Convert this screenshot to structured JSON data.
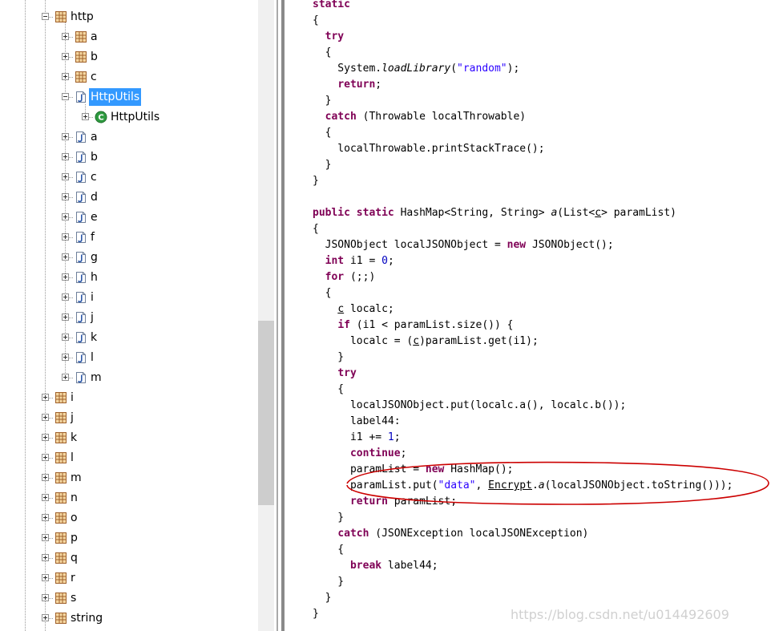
{
  "tree": {
    "rows": [
      {
        "label": "http"
      },
      {
        "label": "a"
      },
      {
        "label": "b"
      },
      {
        "label": "c"
      },
      {
        "label": "HttpUtils"
      },
      {
        "label": "HttpUtils"
      },
      {
        "label": "a"
      },
      {
        "label": "b"
      },
      {
        "label": "c"
      },
      {
        "label": "d"
      },
      {
        "label": "e"
      },
      {
        "label": "f"
      },
      {
        "label": "g"
      },
      {
        "label": "h"
      },
      {
        "label": "i"
      },
      {
        "label": "j"
      },
      {
        "label": "k"
      },
      {
        "label": "l"
      },
      {
        "label": "m"
      },
      {
        "label": "i"
      },
      {
        "label": "j"
      },
      {
        "label": "k"
      },
      {
        "label": "l"
      },
      {
        "label": "m"
      },
      {
        "label": "n"
      },
      {
        "label": "o"
      },
      {
        "label": "p"
      },
      {
        "label": "q"
      },
      {
        "label": "r"
      },
      {
        "label": "s"
      },
      {
        "label": "string"
      }
    ]
  },
  "code": {
    "lines": [
      [
        {
          "t": "static",
          "c": "kw"
        }
      ],
      [
        {
          "t": "{"
        }
      ],
      [
        {
          "t": "  "
        },
        {
          "t": "try",
          "c": "kw"
        }
      ],
      [
        {
          "t": "  {"
        }
      ],
      [
        {
          "t": "    System."
        },
        {
          "t": "loadLibrary",
          "c": "it"
        },
        {
          "t": "("
        },
        {
          "t": "\"random\"",
          "c": "str"
        },
        {
          "t": ");"
        }
      ],
      [
        {
          "t": "    "
        },
        {
          "t": "return",
          "c": "kw"
        },
        {
          "t": ";"
        }
      ],
      [
        {
          "t": "  }"
        }
      ],
      [
        {
          "t": "  "
        },
        {
          "t": "catch",
          "c": "kw"
        },
        {
          "t": " (Throwable localThrowable)"
        }
      ],
      [
        {
          "t": "  {"
        }
      ],
      [
        {
          "t": "    localThrowable.printStackTrace();"
        }
      ],
      [
        {
          "t": "  }"
        }
      ],
      [
        {
          "t": "}"
        }
      ],
      [
        {
          "t": ""
        }
      ],
      [
        {
          "t": "public",
          "c": "kw"
        },
        {
          "t": " "
        },
        {
          "t": "static",
          "c": "kw"
        },
        {
          "t": " HashMap<String, String> "
        },
        {
          "t": "a",
          "c": "it"
        },
        {
          "t": "(List<"
        },
        {
          "t": "c",
          "c": "ul"
        },
        {
          "t": "> paramList)"
        }
      ],
      [
        {
          "t": "{"
        }
      ],
      [
        {
          "t": "  JSONObject localJSONObject = "
        },
        {
          "t": "new",
          "c": "kw"
        },
        {
          "t": " JSONObject();"
        }
      ],
      [
        {
          "t": "  "
        },
        {
          "t": "int",
          "c": "kw"
        },
        {
          "t": " i1 = "
        },
        {
          "t": "0",
          "c": "num"
        },
        {
          "t": ";"
        }
      ],
      [
        {
          "t": "  "
        },
        {
          "t": "for",
          "c": "kw"
        },
        {
          "t": " (;;)"
        }
      ],
      [
        {
          "t": "  {"
        }
      ],
      [
        {
          "t": "    "
        },
        {
          "t": "c",
          "c": "ul"
        },
        {
          "t": " localc;"
        }
      ],
      [
        {
          "t": "    "
        },
        {
          "t": "if",
          "c": "kw"
        },
        {
          "t": " (i1 < paramList.size()) {"
        }
      ],
      [
        {
          "t": "      localc = ("
        },
        {
          "t": "c",
          "c": "ul"
        },
        {
          "t": ")paramList.get(i1);"
        }
      ],
      [
        {
          "t": "    }"
        }
      ],
      [
        {
          "t": "    "
        },
        {
          "t": "try",
          "c": "kw"
        }
      ],
      [
        {
          "t": "    {"
        }
      ],
      [
        {
          "t": "      localJSONObject.put(localc.a(), localc.b());"
        }
      ],
      [
        {
          "t": "      label44:"
        }
      ],
      [
        {
          "t": "      i1 += "
        },
        {
          "t": "1",
          "c": "num"
        },
        {
          "t": ";"
        }
      ],
      [
        {
          "t": "      "
        },
        {
          "t": "continue",
          "c": "kw"
        },
        {
          "t": ";"
        }
      ],
      [
        {
          "t": "      paramList = "
        },
        {
          "t": "new",
          "c": "kw"
        },
        {
          "t": " HashMap();"
        }
      ],
      [
        {
          "t": "      paramList.put("
        },
        {
          "t": "\"data\"",
          "c": "str"
        },
        {
          "t": ", "
        },
        {
          "t": "Encrypt",
          "c": "ul"
        },
        {
          "t": "."
        },
        {
          "t": "a",
          "c": "it"
        },
        {
          "t": "(localJSONObject.toString()));"
        }
      ],
      [
        {
          "t": "      "
        },
        {
          "t": "return",
          "c": "kw"
        },
        {
          "t": " paramList;"
        }
      ],
      [
        {
          "t": "    }"
        }
      ],
      [
        {
          "t": "    "
        },
        {
          "t": "catch",
          "c": "kw"
        },
        {
          "t": " (JSONException localJSONException)"
        }
      ],
      [
        {
          "t": "    {"
        }
      ],
      [
        {
          "t": "      "
        },
        {
          "t": "break",
          "c": "kw"
        },
        {
          "t": " label44;"
        }
      ],
      [
        {
          "t": "    }"
        }
      ],
      [
        {
          "t": "  }"
        }
      ],
      [
        {
          "t": "}"
        }
      ]
    ]
  },
  "watermark": {
    "text": "https://blog.csdn.net/u014492609"
  },
  "colors": {
    "keyword": "#7f0055",
    "string": "#2a00ff",
    "number": "#0000c0",
    "selection": "#3399ff",
    "annotation": "#cc0000"
  },
  "icons": {
    "package": "package-icon",
    "java_file": "java-file-icon",
    "class": "class-icon"
  }
}
